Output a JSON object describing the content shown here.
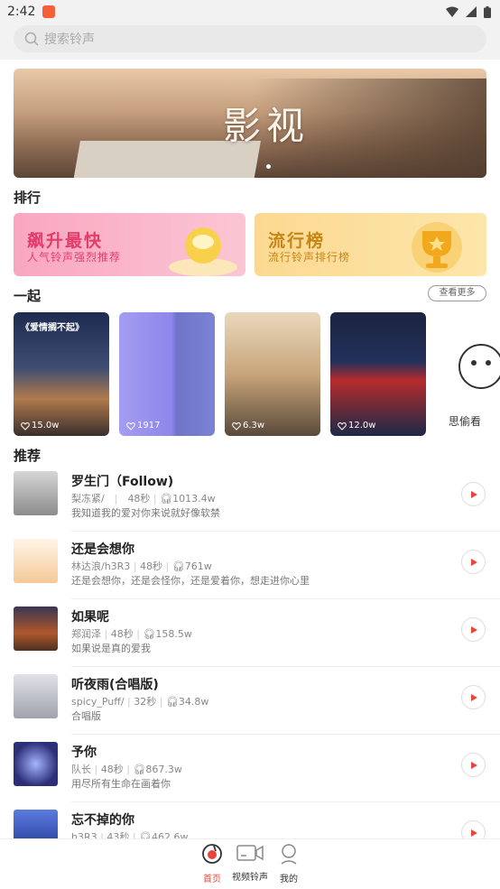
{
  "status": {
    "time": "2:42"
  },
  "search": {
    "placeholder": "搜索铃声"
  },
  "banner": {
    "title": "影视"
  },
  "sections": {
    "ranking": "排行",
    "together": "一起",
    "recommend": "推荐"
  },
  "ranking_cards": [
    {
      "title": "飙升最快",
      "subtitle": "人气铃声强烈推荐"
    },
    {
      "title": "流行榜",
      "subtitle": "流行铃声排行榜"
    }
  ],
  "more_label": "查看更多",
  "video_cards": [
    {
      "likes": "15.0w",
      "overlay_title": "《爱情搁不起》",
      "color": "#2d3a5a"
    },
    {
      "likes": "1917",
      "color": "#8b83e6"
    },
    {
      "likes": "6.3w",
      "color": "#d8b892"
    },
    {
      "likes": "12.0w",
      "color": "#1c2a47"
    }
  ],
  "partial_card_text": "思偷看",
  "songs": [
    {
      "title": "罗生门（Follow)",
      "artist": "梨冻紧/",
      "duration": "48秒",
      "plays": "1013.4w",
      "desc": "我知道我的爱对你来说就好像软禁",
      "thumb": "#b8b8b8"
    },
    {
      "title": "还是会想你",
      "artist": "林达浪/h3R3",
      "duration": "48秒",
      "plays": "761w",
      "desc": "还是会想你，还是会怪你，还是爱着你，想走进你心里",
      "thumb": "#f6c998"
    },
    {
      "title": "如果呢",
      "artist": "郑润泽",
      "duration": "48秒",
      "plays": "158.5w",
      "desc": "如果说是真的爱我",
      "thumb": "#7a4a2d"
    },
    {
      "title": "听夜雨(合唱版)",
      "artist": "spicy_Puff/",
      "duration": "32秒",
      "plays": "34.8w",
      "desc": "合唱版",
      "thumb": "#bfc2c8"
    },
    {
      "title": "予你",
      "artist": "队长",
      "duration": "48秒",
      "plays": "867.3w",
      "desc": "用尽所有生命在画着你",
      "thumb": "#3a3f8a"
    },
    {
      "title": "忘不掉的你",
      "artist": "h3R3",
      "duration": "43秒",
      "plays": "462.6w",
      "desc": "",
      "thumb": "#2a4aa8"
    }
  ],
  "tabs": [
    {
      "label": "首页",
      "active": true
    },
    {
      "label": "视频铃声",
      "active": false
    },
    {
      "label": "我的",
      "active": false
    }
  ],
  "colors": {
    "accent": "#e8453c"
  }
}
